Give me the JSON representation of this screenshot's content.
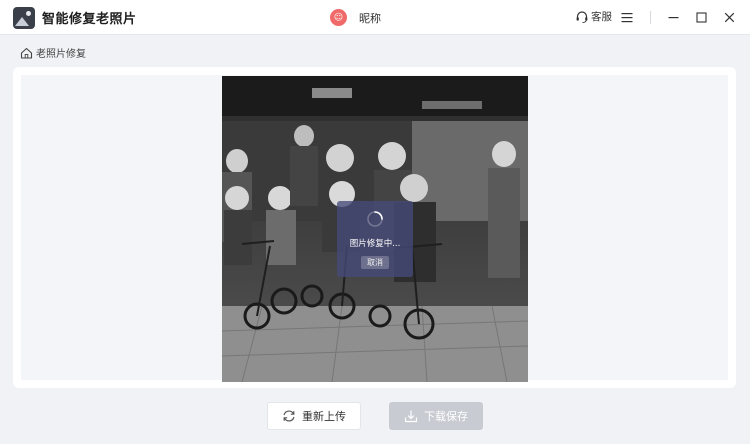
{
  "app": {
    "title": "智能修复老照片",
    "icon": "photo-restore-logo-icon"
  },
  "user": {
    "avatar_icon": "user-avatar-icon",
    "avatar_color": "#f06a6a",
    "nickname": "昵称"
  },
  "header": {
    "service_label": "客服",
    "service_icon": "headset-icon",
    "menu_icon": "hamburger-menu-icon",
    "minimize_icon": "minimize-icon",
    "maximize_icon": "maximize-icon",
    "close_icon": "close-icon"
  },
  "breadcrumb": {
    "home_icon": "home-icon",
    "label": "老照片修复"
  },
  "processing": {
    "status_text": "图片修复中...",
    "cancel_label": "取消",
    "spinner_icon": "loading-spinner-icon",
    "overlay_color": "#464a7a"
  },
  "actions": {
    "reupload_label": "重新上传",
    "reupload_icon": "refresh-icon",
    "download_label": "下载保存",
    "download_icon": "download-icon",
    "download_disabled": true
  },
  "colors": {
    "background": "#f1f2f6",
    "card": "#ffffff",
    "disabled_button": "#c9cbd2"
  }
}
